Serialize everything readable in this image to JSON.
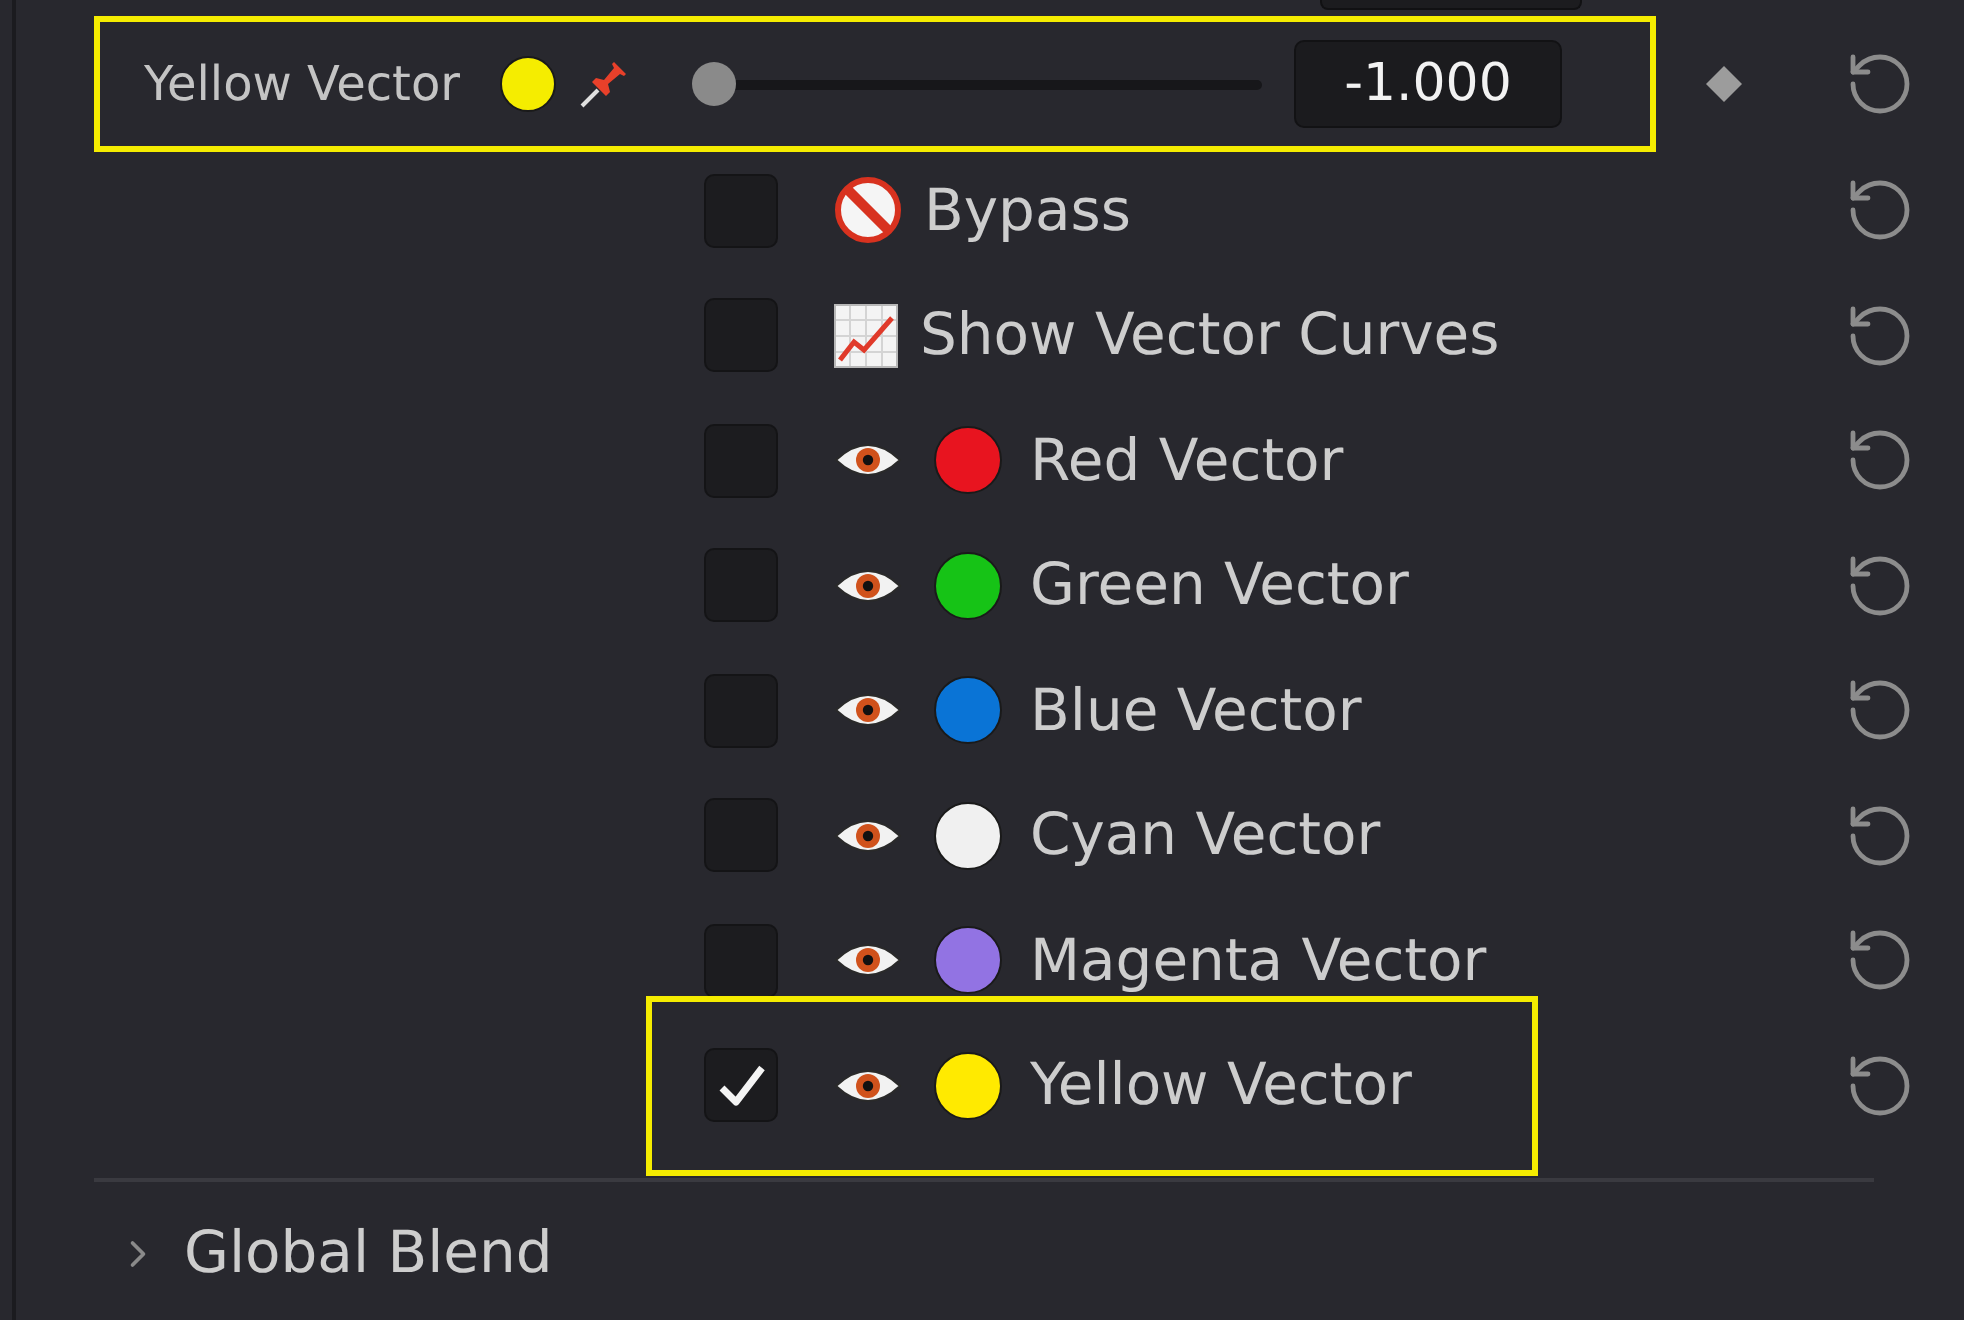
{
  "parameter": {
    "label": "Yellow Vector",
    "color": "#f5ed00",
    "pinned": true,
    "level": 0,
    "value": "-1.000",
    "highlighted": true
  },
  "options": [
    {
      "kind": "bypass",
      "label": "Bypass",
      "checked": false,
      "highlighted": false
    },
    {
      "kind": "curves",
      "label": "Show Vector Curves",
      "checked": false,
      "highlighted": false
    },
    {
      "kind": "vector",
      "label": "Red Vector",
      "color": "#e8141f",
      "checked": false,
      "highlighted": false
    },
    {
      "kind": "vector",
      "label": "Green Vector",
      "color": "#16c316",
      "checked": false,
      "highlighted": false
    },
    {
      "kind": "vector",
      "label": "Blue Vector",
      "color": "#0a74d6",
      "checked": false,
      "highlighted": false
    },
    {
      "kind": "vector",
      "label": "Cyan Vector",
      "color": "#f0f0f0",
      "checked": false,
      "highlighted": false
    },
    {
      "kind": "vector",
      "label": "Magenta Vector",
      "color": "#9273e3",
      "checked": false,
      "highlighted": false
    },
    {
      "kind": "vector",
      "label": "Yellow Vector",
      "color": "#ffea00",
      "checked": true,
      "highlighted": true
    }
  ],
  "global_blend": {
    "label": "Global Blend",
    "expanded": false
  }
}
